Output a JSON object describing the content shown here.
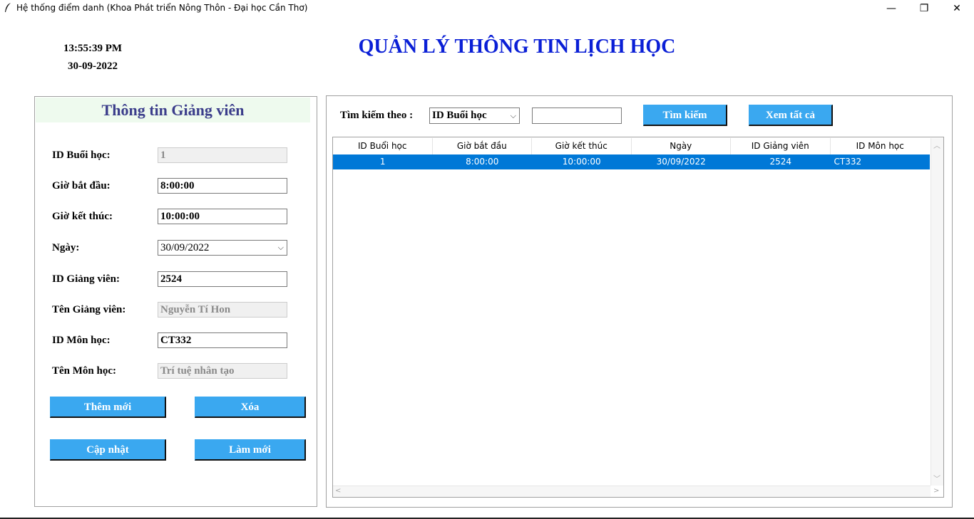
{
  "window": {
    "title": "Hệ thống điểm danh (Khoa Phát triển Nông Thôn - Đại học Cần Thơ)",
    "icon": "feather-icon",
    "minimize": "—",
    "maximize": "❐",
    "close": "✕"
  },
  "clock": {
    "time": "13:55:39 PM",
    "date": "30-09-2022"
  },
  "page_title": "QUẢN LÝ THÔNG TIN LỊCH HỌC",
  "form": {
    "header": "Thông tin Giảng viên",
    "fields": [
      {
        "label": "ID Buổi học:",
        "value": "1"
      },
      {
        "label": "Giờ bắt đầu:",
        "value": "8:00:00"
      },
      {
        "label": "Giờ kết thúc:",
        "value": "10:00:00"
      },
      {
        "label": "Ngày:",
        "value": "30/09/2022"
      },
      {
        "label": "ID Giảng viên:",
        "value": "2524"
      },
      {
        "label": "Tên Giảng viên:",
        "value": "Nguyễn Tí Hon"
      },
      {
        "label": "ID Môn học:",
        "value": "CT332"
      },
      {
        "label": "Tên Môn học:",
        "value": "Trí tuệ nhân tạo"
      }
    ],
    "buttons": {
      "add": "Thêm mới",
      "delete": "Xóa",
      "update": "Cập nhật",
      "refresh": "Làm mới"
    }
  },
  "search": {
    "label": "Tìm kiếm theo :",
    "selected_option": "ID Buổi học",
    "value": "",
    "search_button": "Tìm kiếm",
    "view_all_button": "Xem tất cả"
  },
  "table": {
    "columns": [
      "ID Buổi học",
      "Giờ bắt đầu",
      "Giờ kết thúc",
      "Ngày",
      "ID Giảng viên",
      "ID Môn học"
    ],
    "rows": [
      [
        "1",
        "8:00:00",
        "10:00:00",
        "30/09/2022",
        "2524",
        "CT332"
      ]
    ],
    "selected_row": 0
  },
  "colors": {
    "title": "#0a1fd6",
    "panel_header_text": "#3b3d8b",
    "panel_header_bg": "#eefaee",
    "button": "#3aa8f0",
    "selection": "#0078d7"
  }
}
